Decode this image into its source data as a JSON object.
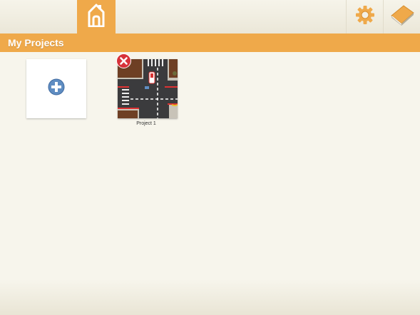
{
  "toolbar": {
    "home_icon": "home-icon",
    "settings_icon": "gear-icon",
    "help_icon": "book-icon"
  },
  "section": {
    "title": "My Projects"
  },
  "projects": {
    "new_project_icon": "plus-circle-icon",
    "items": [
      {
        "name": "Project 1",
        "thumbnail": "street-intersection-scene",
        "delete_icon": "close-icon"
      }
    ]
  },
  "colors": {
    "accent": "#efa94a",
    "background": "#f7f5ec",
    "topbar": "#efece1",
    "delete_red": "#d7323a",
    "plus_blue": "#5f8dc2"
  }
}
